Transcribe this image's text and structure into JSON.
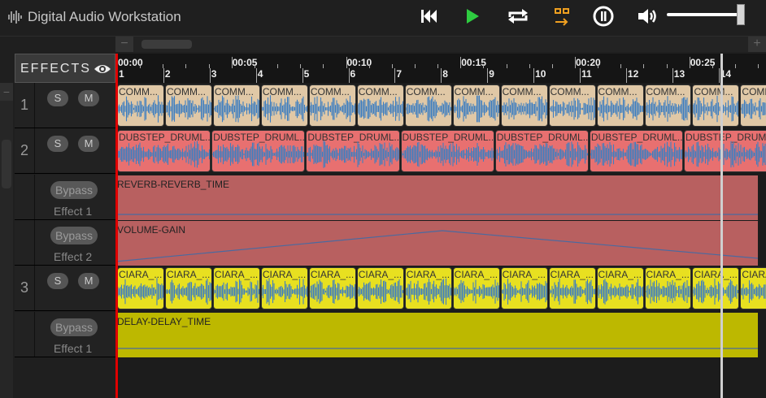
{
  "app": {
    "title": "Digital Audio Workstation"
  },
  "transport": {
    "rewind_icon": "skip-to-start-icon",
    "play_icon": "play-icon",
    "loop_icon": "loop-icon",
    "snap_icon": "snap-icon",
    "metronome_icon": "metronome-icon",
    "volume_icon": "volume-icon",
    "play_color": "#2ecc40",
    "snap_color": "#f0a020",
    "volume_level": 0.96
  },
  "effects_header": {
    "label": "EFFECTS",
    "icon": "eye-icon"
  },
  "ruler": {
    "times": [
      "00:00",
      "00:05",
      "00:10",
      "00:15",
      "00:20",
      "00:25"
    ],
    "bars": [
      "1",
      "2",
      "3",
      "4",
      "5",
      "6",
      "7",
      "8",
      "9",
      "10",
      "11",
      "12",
      "13",
      "14"
    ]
  },
  "tracks": [
    {
      "number": "1",
      "solo_label": "S",
      "mute_label": "M",
      "clip_label": "COMM...",
      "clip_color": "#e0c8a6",
      "wave_color": "#3f7fc0",
      "clip_count": 14
    },
    {
      "number": "2",
      "solo_label": "S",
      "mute_label": "M",
      "clip_label": "DUBSTEP_DRUML...",
      "clip_color": "#e87070",
      "wave_color": "#3f7fc0",
      "clip_count": 7
    },
    {
      "number": "3",
      "solo_label": "S",
      "mute_label": "M",
      "clip_label": "CIARA_...",
      "clip_color": "#e8e020",
      "wave_color": "#3f7fc0",
      "clip_count": 14
    }
  ],
  "effects": [
    {
      "bypass_label": "Bypass",
      "effect_label": "Effect 1",
      "automation_label": "REVERB-REVERB_TIME",
      "lane_color": "#b86060"
    },
    {
      "bypass_label": "Bypass",
      "effect_label": "Effect 2",
      "automation_label": "VOLUME-GAIN",
      "lane_color": "#b86060"
    },
    {
      "bypass_label": "Bypass",
      "effect_label": "Effect 1",
      "automation_label": "DELAY-DELAY_TIME",
      "lane_color": "#bdb800"
    }
  ]
}
